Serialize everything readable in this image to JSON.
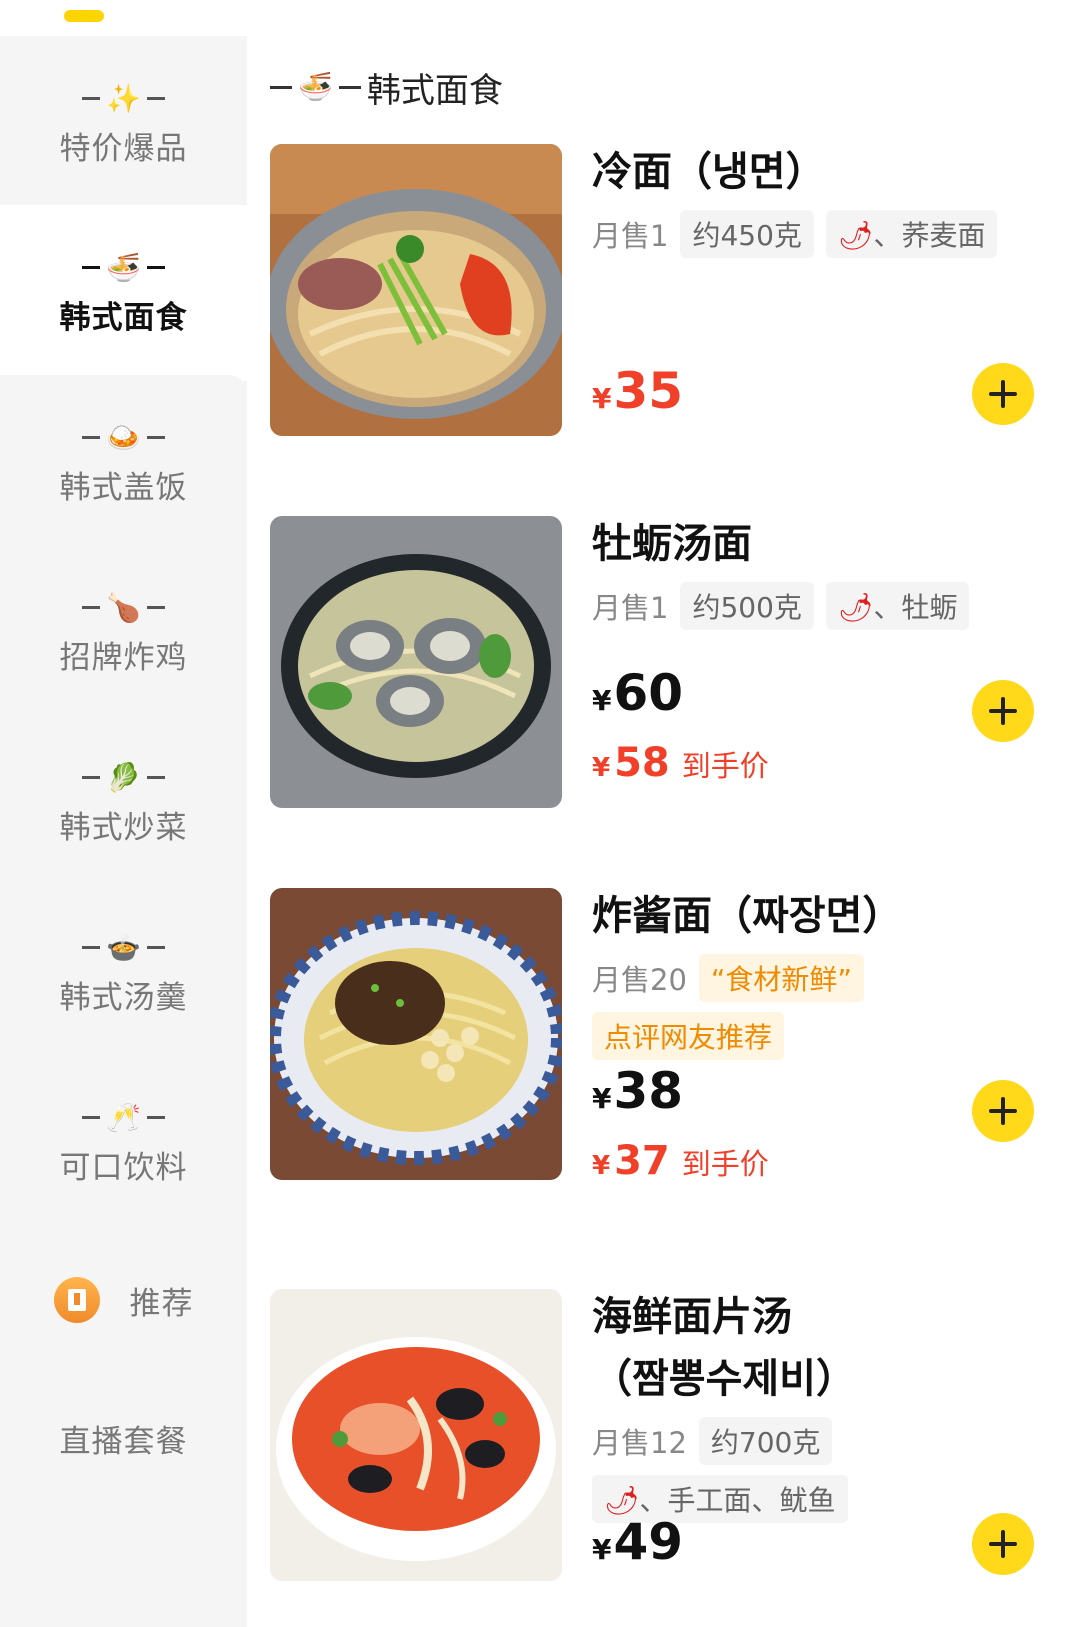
{
  "sidebar": {
    "items": [
      {
        "label": "特价爆品",
        "icon": "sparkles-icon",
        "glyph": "✨"
      },
      {
        "label": "韩式面食",
        "icon": "noodles-icon",
        "glyph": "🍜"
      },
      {
        "label": "韩式盖饭",
        "icon": "rice-bowl-icon",
        "glyph": "🍛"
      },
      {
        "label": "招牌炸鸡",
        "icon": "chicken-leg-icon",
        "glyph": "🍗"
      },
      {
        "label": "韩式炒菜",
        "icon": "lettuce-icon",
        "glyph": "🥬"
      },
      {
        "label": "韩式汤羹",
        "icon": "soup-icon",
        "glyph": "🍲"
      },
      {
        "label": "可口饮料",
        "icon": "cheers-icon",
        "glyph": "🥂"
      },
      {
        "label": "推荐",
        "icon": "bookmark-badge-icon"
      },
      {
        "label": "直播套餐"
      }
    ],
    "active_index": 1
  },
  "section": {
    "title": "韩式面食",
    "glyph": "🍜"
  },
  "products": [
    {
      "name": "冷面（냉면）",
      "sales": "月售1",
      "tags": [
        "约450克"
      ],
      "spicy_tag": "、荞麦面",
      "price": "35",
      "price_highlight": true
    },
    {
      "name": "牡蛎汤面",
      "sales": "月售1",
      "tags": [
        "约500克"
      ],
      "spicy_tag": "、牡蛎",
      "price": "60",
      "deal_price": "58",
      "deal_label": "到手价"
    },
    {
      "name": "炸酱面（짜장면）",
      "sales": "月售20",
      "quote_tag": "“食材新鲜”",
      "recommend_tag": "点评网友推荐",
      "price": "38",
      "deal_price": "37",
      "deal_label": "到手价"
    },
    {
      "name_line1": "海鲜面片汤",
      "name_line2": "（짬뽕수제비）",
      "sales": "月售12",
      "tags": [
        "约700克"
      ],
      "spicy_tag": "、手工面、鱿鱼",
      "price": "49"
    }
  ],
  "currency": "¥",
  "spicy_glyph": "🌶",
  "colors": {
    "accent": "#ffd91a",
    "price_red": "#f0402a",
    "tag_orange": "#f08a00"
  }
}
